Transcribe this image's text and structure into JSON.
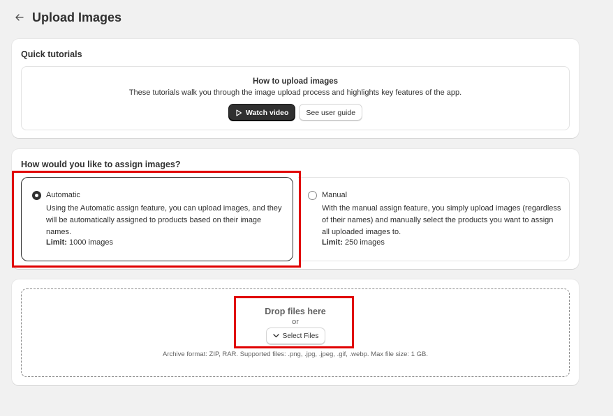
{
  "header": {
    "title": "Upload Images",
    "back_icon": "arrow-left-icon"
  },
  "tutorials": {
    "heading": "Quick tutorials",
    "title": "How to upload images",
    "description": "These tutorials walk you through the image upload process and highlights key features of the app.",
    "watch_label": "Watch video",
    "guide_label": "See user guide"
  },
  "assign": {
    "heading": "How would you like to assign images?",
    "automatic": {
      "title": "Automatic",
      "description": "Using the Automatic assign feature, you can upload images, and they will be automatically assigned to products based on their image names.",
      "limit_label": "Limit:",
      "limit_value": "1000 images",
      "selected": true
    },
    "manual": {
      "title": "Manual",
      "description": "With the manual assign feature, you simply upload images (regardless of their names) and manually select the products you want to assign all uploaded images to.",
      "limit_label": "Limit:",
      "limit_value": "250 images",
      "selected": false
    }
  },
  "upload": {
    "drop_title": "Drop files here",
    "or": "or",
    "select_label": "Select Files",
    "hint": "Archive format: ZIP, RAR. Supported files: .png, .jpg, .jpeg, .gif, .webp. Max file size: 1 GB."
  },
  "colors": {
    "highlight": "#e00000",
    "primary_button": "#303030",
    "background": "#f1f1f1"
  }
}
